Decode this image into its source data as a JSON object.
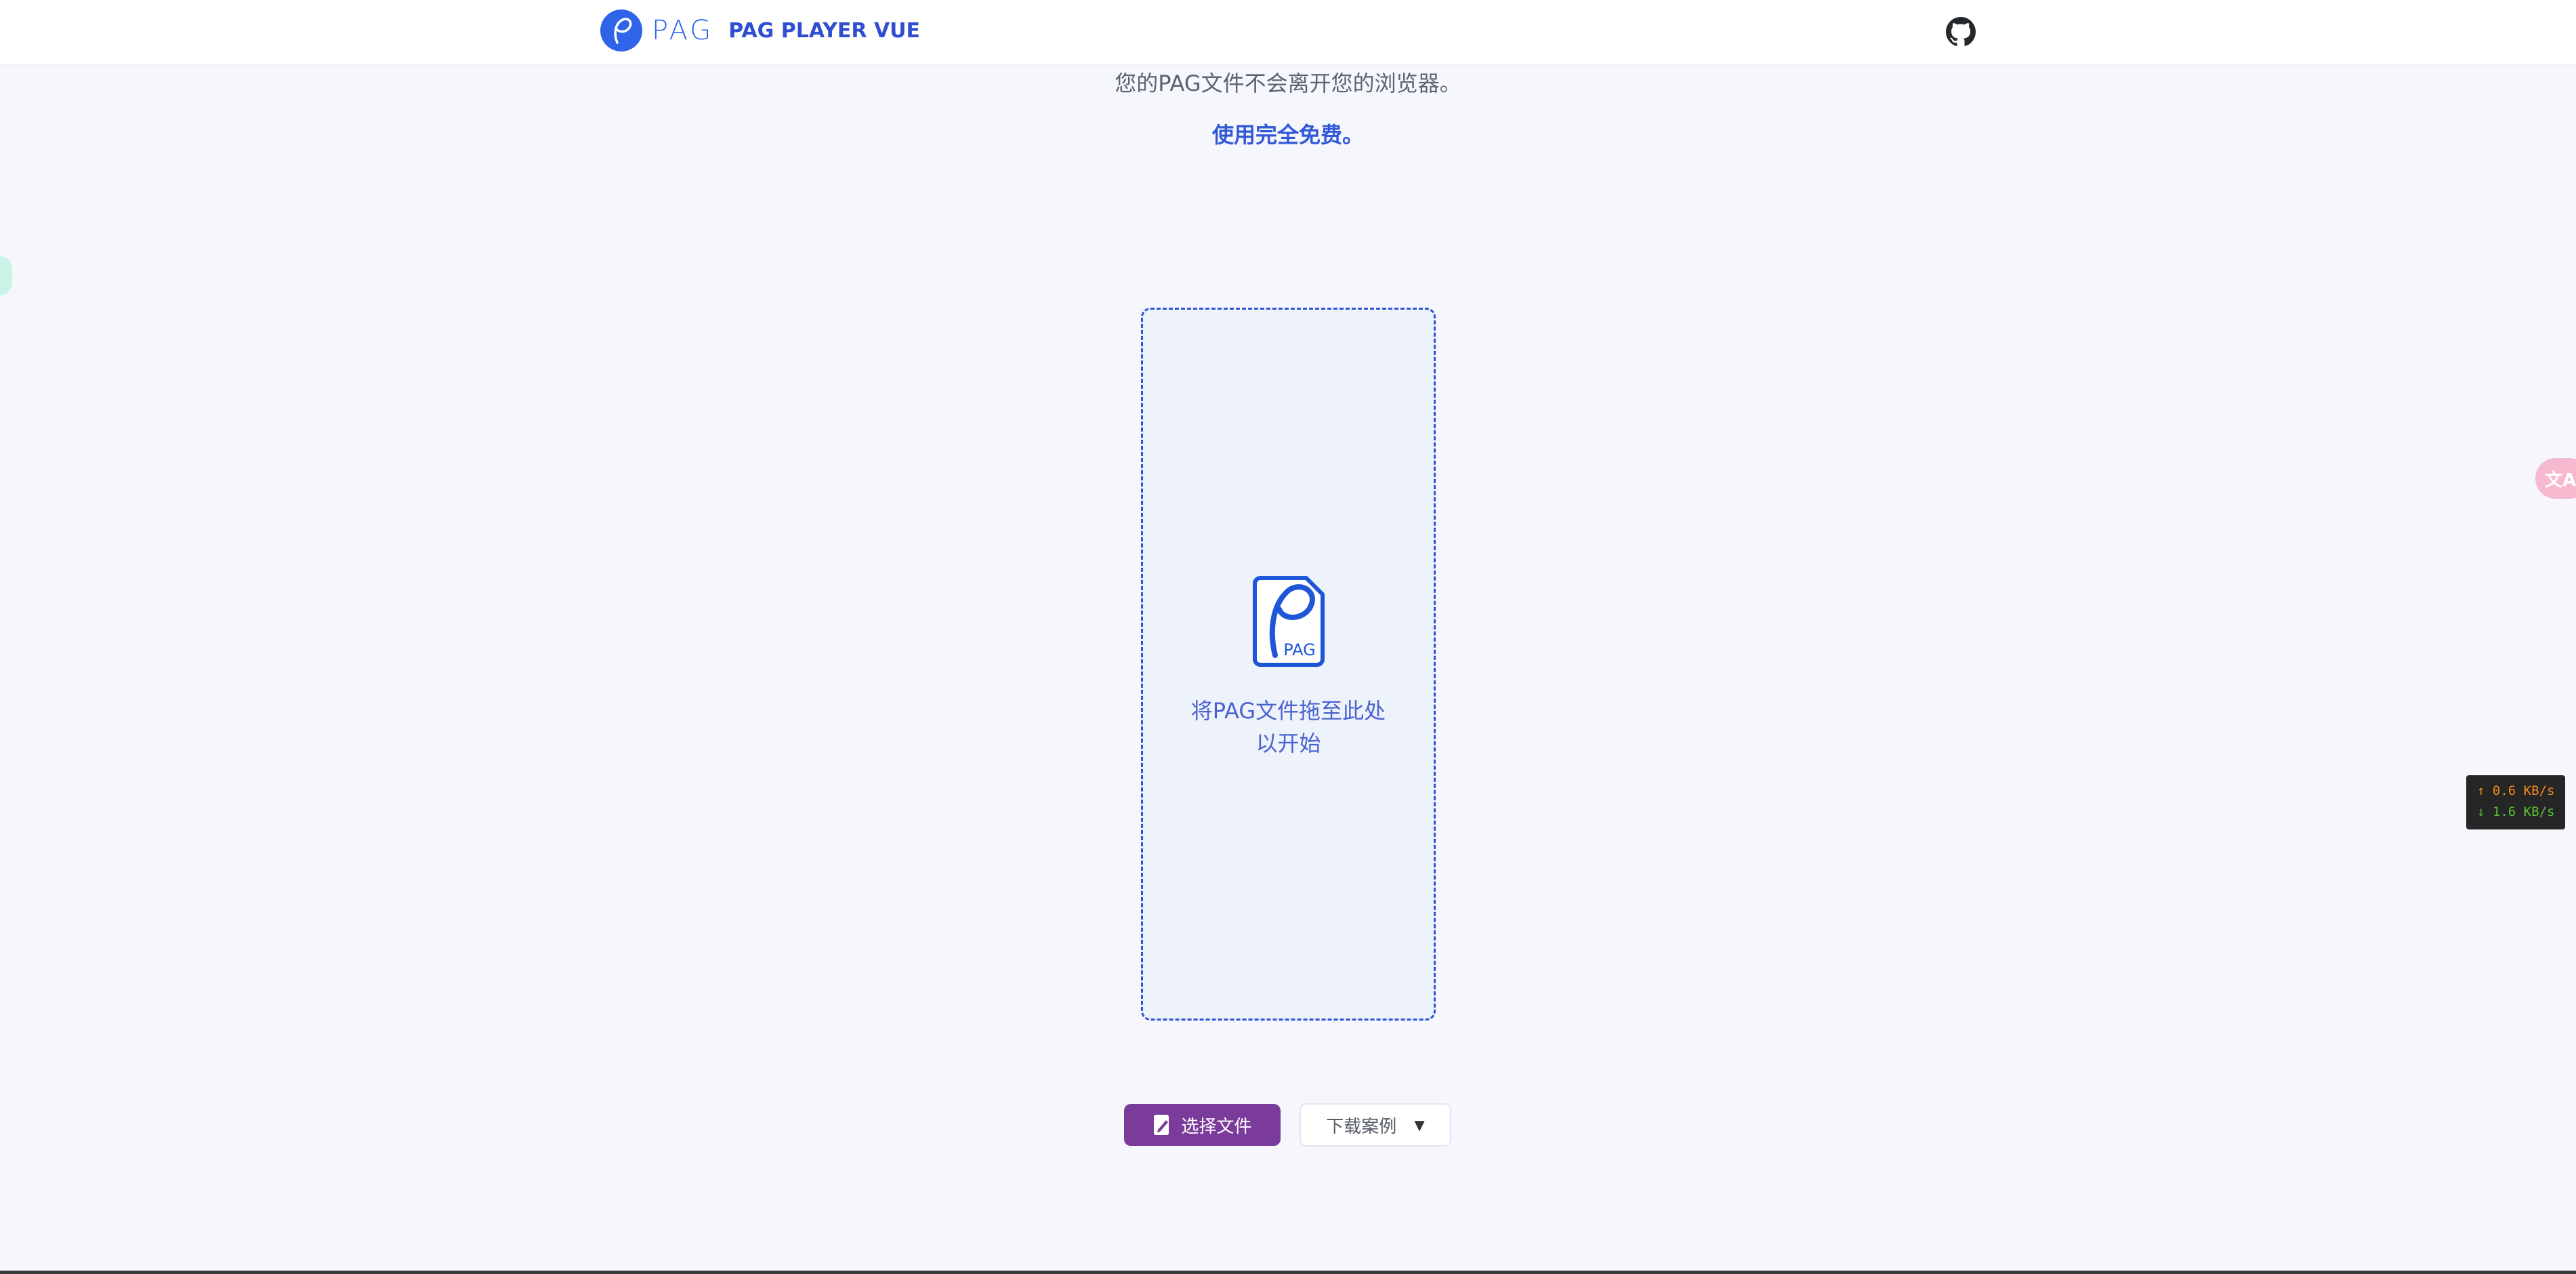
{
  "header": {
    "brand_wordmark": "PAG",
    "brand_name": "PAG PLAYER VUE",
    "github_icon": "github-icon"
  },
  "intro": {
    "privacy_text": "您的PAG文件不会离开您的浏览器。",
    "free_text": "使用完全免费。"
  },
  "dropzone": {
    "icon": "pag-file-icon",
    "icon_label": "PAG",
    "line1": "将PAG文件拖至此处",
    "line2": "以开始"
  },
  "actions": {
    "select_file_label": "选择文件",
    "select_file_icon": "file-edit-icon",
    "download_examples_label": "下载案例",
    "download_caret": "▼"
  },
  "overlays": {
    "translate_label": "文A",
    "net_speed": {
      "upload": "↑ 0.6 KB/s",
      "download": "↓ 1.6 KB/s"
    }
  },
  "colors": {
    "accent": "#2f63e8",
    "button_primary": "#7b3b9b",
    "background": "#f5f7fc"
  }
}
